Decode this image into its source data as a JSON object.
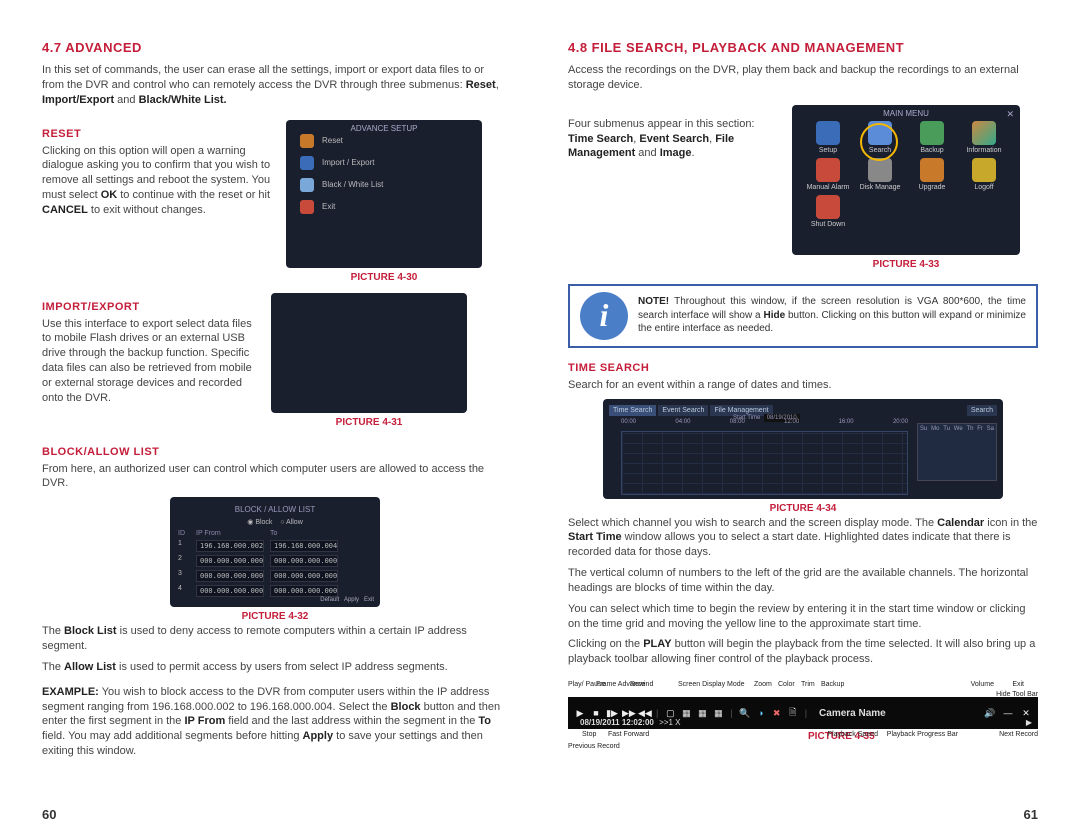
{
  "left": {
    "h_advanced": "4.7 ADVANCED",
    "intro": "In this set of commands, the user can erase all the settings, import or export data files to or from the DVR and control who can remotely access the DVR through three submenus:",
    "intro_bold": "Reset",
    "intro_b2": "Import/Export",
    "intro_b3": "Black/White List.",
    "reset_h": "RESET",
    "reset_p1": "Clicking on this option will open a warning dialogue asking you to confirm that you wish to remove all settings and reboot the system. You must select ",
    "reset_b1": "OK",
    "reset_p2": " to continue with the reset or hit ",
    "reset_b2": "CANCEL",
    "reset_p3": " to exit without changes.",
    "fig30": "PICTURE 4-30",
    "adv_title": "ADVANCE SETUP",
    "adv_items": [
      "Reset",
      "Import / Export",
      "Black / White List",
      "Exit"
    ],
    "impexp_h": "IMPORT/EXPORT",
    "impexp_p": "Use this interface to export select data files to mobile Flash drives or an external USB drive through the backup function. Specific data files can also be retrieved from mobile or external storage devices and recorded onto the DVR.",
    "fig31": "PICTURE 4-31",
    "block_h": "BLOCK/ALLOW LIST",
    "block_p": "From here, an authorized user can control which computer users are allowed to access the DVR.",
    "fig32_title": "BLOCK / ALLOW LIST",
    "fig32_block": "Block",
    "fig32_allow": "Allow",
    "fig32_cols": [
      "ID",
      "IP From",
      "To"
    ],
    "fig32_rows": [
      [
        "1",
        "196.168.000.002",
        "196.168.000.004"
      ],
      [
        "2",
        "000.000.000.000",
        "000.000.000.000"
      ],
      [
        "3",
        "000.000.000.000",
        "000.000.000.000"
      ],
      [
        "4",
        "000.000.000.000",
        "000.000.000.000"
      ]
    ],
    "fig32_btns": [
      "Default",
      "Apply",
      "Exit"
    ],
    "fig32": "PICTURE 4-32",
    "block_p2a": "The ",
    "block_b1": "Block List",
    "block_p2b": " is used to deny access to remote computers within a certain IP address segment.",
    "allow_p_a": "The ",
    "allow_b": "Allow List",
    "allow_p_b": " is used to permit access by users from select IP address segments.",
    "ex_b": "EXAMPLE:",
    "ex_p": " You wish to block access to the DVR from computer users within the IP address segment ranging from 196.168.000.002 to 196.168.000.004. Select the ",
    "ex_b2": "Block",
    "ex_p2": " button and then enter the first segment in the ",
    "ex_b3": "IP From",
    "ex_p3": " field and the last address within the segment in the ",
    "ex_b4": "To",
    "ex_p4": " field. You may add additional segments before hitting ",
    "ex_b5": "Apply",
    "ex_p5": " to save your settings and then exiting this window.",
    "page": "60"
  },
  "right": {
    "h_fs": "4.8 FILE SEARCH, PLAYBACK AND MANAGEMENT",
    "intro": "Access the recordings on the DVR, play them back and backup the recordings to an external storage device.",
    "four_p1": "Four submenus appear in this section: ",
    "four_b1": "Time Search",
    "four_sep": ", ",
    "four_b2": "Event Search",
    "four_b3": "File Management",
    "four_p2": " and ",
    "four_b4": "Image",
    "four_p3": ".",
    "fig33": "PICTURE 4-33",
    "menu_title": "MAIN MENU",
    "menu_items": [
      "Setup",
      "Search",
      "Backup",
      "Information",
      "Manual Alarm",
      "Disk Manage",
      "Upgrade",
      "Logoff",
      "Shut Down"
    ],
    "note_b": "NOTE!",
    "note_p": " Throughout this window, if the screen resolution is VGA 800*600, the time search interface will show a ",
    "note_b2": "Hide",
    "note_p2": " button. Clicking on this button will expand or minimize the entire interface as needed.",
    "ts_h": "TIME SEARCH",
    "ts_p": "Search for an event within a range of dates and times.",
    "fig34": "PICTURE 4-34",
    "srch_tabs": [
      "Time Search",
      "Event Search",
      "File Management"
    ],
    "srch_btn": "Search",
    "srch_start": "Start Time",
    "srch_date": "08/19/2010",
    "srch_hours": [
      "00:00",
      "04:00",
      "08:00",
      "12:00",
      "16:00",
      "20:00"
    ],
    "srch_days": [
      "Su",
      "Mo",
      "Tu",
      "We",
      "Th",
      "Fr",
      "Sa"
    ],
    "sel_p1": "Select which channel you wish to search and the screen display mode. The ",
    "sel_b1": "Calendar",
    "sel_p2": " icon in the ",
    "sel_b2": "Start Time",
    "sel_p3": " window allows you to select a start date. Highlighted dates indicate that there is recorded data for those days.",
    "vert_p": "The vertical column of numbers to the left of the grid are the available channels. The horizontal headings are blocks of time within the day.",
    "you_p": "You can select which time to begin the review by entering it in the start time window or clicking on the time grid and moving the yellow line to the approximate start time.",
    "play_p1": "Clicking on the ",
    "play_b": "PLAY",
    "play_p2": " button will begin the playback from the time selected. It will also bring up a playback toolbar allowing finer control of the playback process.",
    "pt_top": {
      "play": "Play/\nPause",
      "frame": "Frame\nAdvance",
      "rewind": "Rewind",
      "display": "Screen Display\nMode",
      "zoom": "Zoom",
      "color": "Color",
      "trim": "Trim",
      "backup": "Backup",
      "volume": "Volume",
      "exit": "Exit",
      "hide": "Hide\nTool Bar"
    },
    "pt_camera": "Camera Name",
    "pt_ts": "08/19/2011 12:02:00",
    "pt_speed": ">>1 X",
    "pt_bot": {
      "stop": "Stop",
      "ff": "Fast\nForward",
      "prev": "Previous\nRecord",
      "pspeed": "Playback\nSpeed",
      "pbar": "Playback\nProgress Bar",
      "next": "Next\nRecord"
    },
    "fig35": "PICTURE 4-35",
    "page": "61"
  }
}
